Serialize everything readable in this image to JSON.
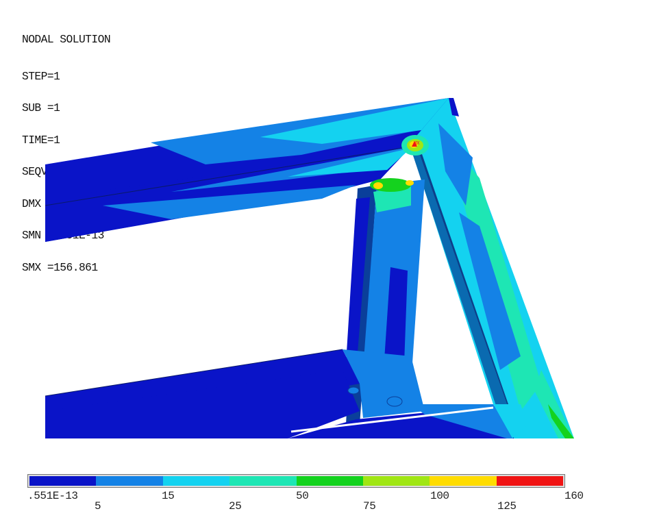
{
  "header": {
    "title": "NODAL SOLUTION",
    "lines": [
      "STEP=1",
      "SUB =1",
      "TIME=1",
      "SEQV       (AVG)",
      "DMX =2.4654",
      "SMN =.551E-13",
      "SMX =156.861"
    ]
  },
  "contour": {
    "colors": [
      "#0a14c8",
      "#1482e6",
      "#14d2f0",
      "#1ee6b4",
      "#14d21e",
      "#a0e614",
      "#ffdc00",
      "#f01414"
    ],
    "levels": [
      ".551E-13",
      "5",
      "15",
      "25",
      "50",
      "75",
      "100",
      "125",
      "160"
    ],
    "max_marker": "MX"
  }
}
